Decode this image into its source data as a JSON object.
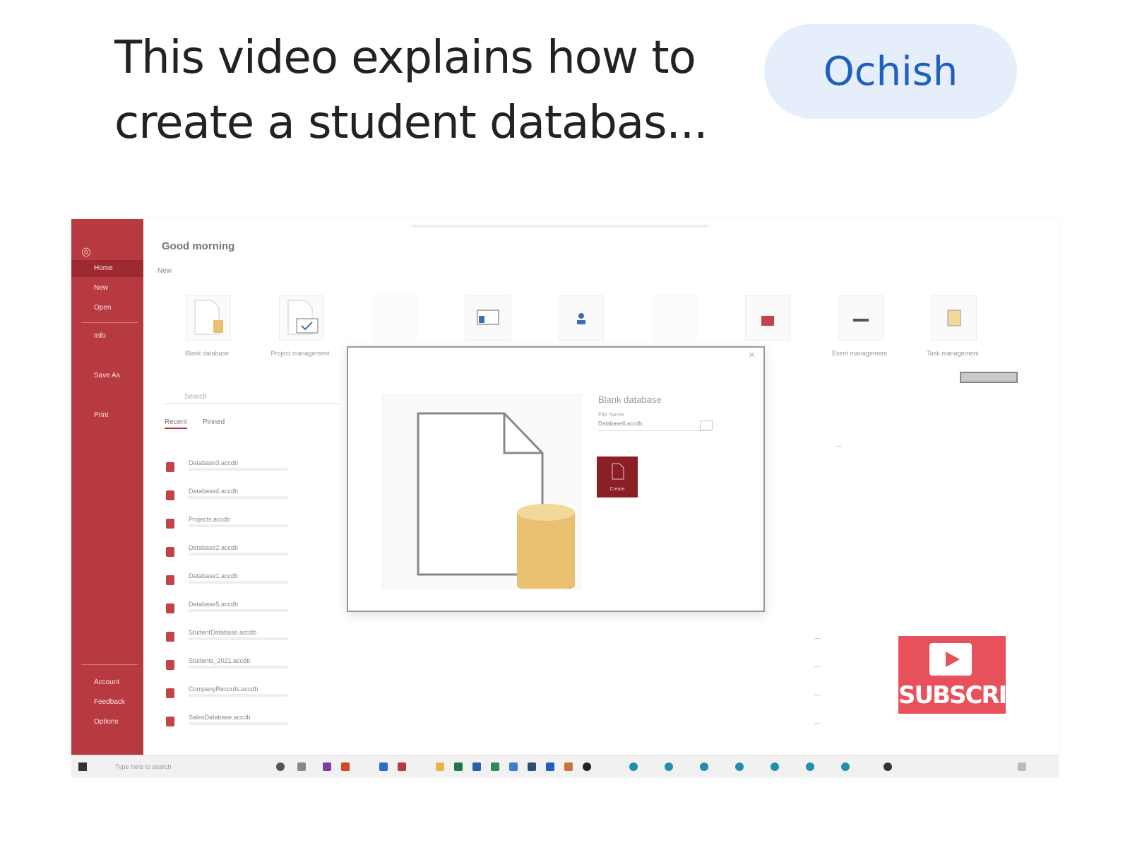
{
  "card": {
    "description": "This video explains how to create a student databas...",
    "open_label": "Ochish"
  },
  "video": {
    "app": {
      "greeting": "Good morning",
      "new_label": "New",
      "sidebar": [
        {
          "label": "Home",
          "active": true
        },
        {
          "label": "New"
        },
        {
          "label": "Open"
        },
        {
          "label": "Info"
        },
        {
          "label": "Save As"
        },
        {
          "label": "Print"
        },
        {
          "label": "Account"
        },
        {
          "label": "Feedback"
        },
        {
          "label": "Options"
        }
      ],
      "templates": [
        {
          "label": "Blank database",
          "icon": "blank-database-icon"
        },
        {
          "label": "Project management",
          "icon": "project-icon"
        },
        {
          "label": "",
          "icon": "template-icon"
        },
        {
          "label": "",
          "icon": "template-icon"
        },
        {
          "label": "",
          "icon": "contacts-icon"
        },
        {
          "label": "",
          "icon": "template-icon"
        },
        {
          "label": "",
          "icon": "template-icon"
        },
        {
          "label": "Event management",
          "icon": "event-icon"
        },
        {
          "label": "Task management",
          "icon": "task-icon"
        }
      ],
      "search_placeholder": "Search",
      "tabs": [
        "Recent",
        "Pinned"
      ],
      "recent_files": [
        {
          "name": "Database3.accdb"
        },
        {
          "name": "Database4.accdb"
        },
        {
          "name": "Projects.accdb"
        },
        {
          "name": "Database2.accdb"
        },
        {
          "name": "Database1.accdb"
        },
        {
          "name": "Database5.accdb"
        },
        {
          "name": "StudentDatabase.accdb"
        },
        {
          "name": "Students_2021.accdb"
        },
        {
          "name": "CompanyRecords.accdb"
        },
        {
          "name": "SalesDatabase.accdb"
        }
      ]
    },
    "dialog": {
      "title": "Blank database",
      "file_name_label": "File Name",
      "file_name_value": "Database6.accdb",
      "create_label": "Create"
    },
    "subscribe_label": "SUBSCRIBE",
    "taskbar": {
      "search_placeholder": "Type here to search"
    },
    "colors": {
      "access_red": "#b73a40",
      "subscribe_red": "#e8505b",
      "button_bg": "#e6eefb",
      "button_text": "#1f5fbf"
    }
  }
}
